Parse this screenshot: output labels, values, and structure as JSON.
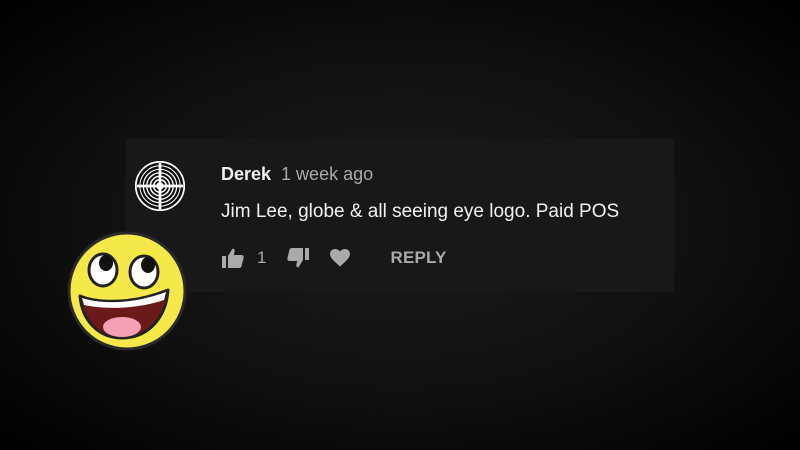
{
  "comment": {
    "author": "Derek",
    "timestamp": "1 week ago",
    "text": "Jim Lee, globe & all seeing eye logo. Paid POS",
    "like_count": "1",
    "reply_label": "REPLY"
  },
  "icons": {
    "avatar": "concentric-circles-avatar",
    "like": "thumbs-up-icon",
    "dislike": "thumbs-down-icon",
    "heart": "heart-icon",
    "overlay": "awesome-face-smiley"
  },
  "colors": {
    "card_background": "#181818",
    "primary_text": "#f1f1f1",
    "secondary_text": "#aaaaaa",
    "smiley_yellow": "#f5e94a"
  }
}
